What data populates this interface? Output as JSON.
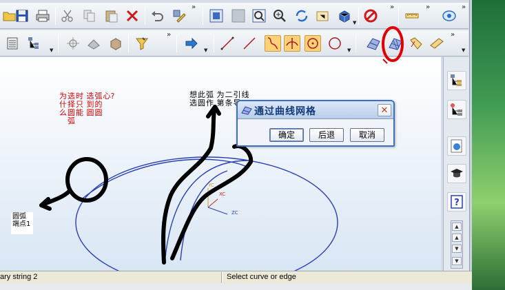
{
  "toolbar_row1": {
    "buttons": [
      {
        "icon": "open-folder-icon"
      },
      {
        "icon": "save-icon"
      },
      {
        "icon": "print-icon"
      },
      {
        "icon": "cut-icon"
      },
      {
        "icon": "copy-icon"
      },
      {
        "icon": "paste-icon"
      },
      {
        "icon": "delete-icon"
      },
      {
        "icon": "undo-icon"
      },
      {
        "icon": "edit-object-icon"
      },
      {
        "icon": "fit-view-icon"
      },
      {
        "icon": "zoom-window-icon"
      },
      {
        "icon": "zoom-icon"
      },
      {
        "icon": "rotate-icon"
      },
      {
        "icon": "pan-icon"
      },
      {
        "icon": "shaded-icon"
      },
      {
        "icon": "hide-icon"
      },
      {
        "icon": "measure-icon"
      },
      {
        "icon": "analysis-icon"
      }
    ]
  },
  "toolbar_row2": {
    "buttons": [
      {
        "icon": "layer-icon"
      },
      {
        "icon": "part-navigator-icon"
      },
      {
        "icon": "point-icon"
      },
      {
        "icon": "datum-plane-icon"
      },
      {
        "icon": "block-icon"
      },
      {
        "icon": "select-filter-icon"
      },
      {
        "icon": "arrow-right-icon"
      },
      {
        "icon": "line-icon"
      },
      {
        "icon": "line2-icon"
      },
      {
        "icon": "spline-icon"
      },
      {
        "icon": "cross-icon"
      },
      {
        "icon": "circle-center-icon"
      },
      {
        "icon": "circle-icon"
      },
      {
        "icon": "through-curves-icon"
      },
      {
        "icon": "through-curve-mesh-icon"
      },
      {
        "icon": "swept-icon"
      },
      {
        "icon": "bounded-plane-icon"
      }
    ]
  },
  "sidebar": {
    "buttons": [
      {
        "icon": "assembly-navigator-icon"
      },
      {
        "icon": "part-tree-icon"
      },
      {
        "icon": "web-browser-icon"
      },
      {
        "icon": "training-icon"
      },
      {
        "icon": "help-icon"
      }
    ]
  },
  "dialog": {
    "title": "通过曲线网格",
    "close_glyph": "✕",
    "ok_label": "确定",
    "back_label": "后退",
    "cancel_label": "取消"
  },
  "annotations": {
    "red_note_columns": [
      "为什么",
      "选择圆弧",
      "时只能",
      "选到圆",
      "弧的圆",
      "心?"
    ],
    "black_note_columns": [
      "想选",
      "此圆",
      "弧作",
      "为第",
      "二条",
      "引导",
      "线"
    ],
    "endpoint_label": "圆弧端点1"
  },
  "axis_labels": {
    "y": "YC",
    "x": "XC",
    "z": "ZC"
  },
  "status": {
    "left": "ary string 2",
    "right": "Select curve or edge"
  },
  "colors": {
    "curve_blue": "#2b3fb5",
    "annotation_red": "#d10000",
    "highlight_red": "#e00000",
    "dialog_title": "#123a78"
  }
}
